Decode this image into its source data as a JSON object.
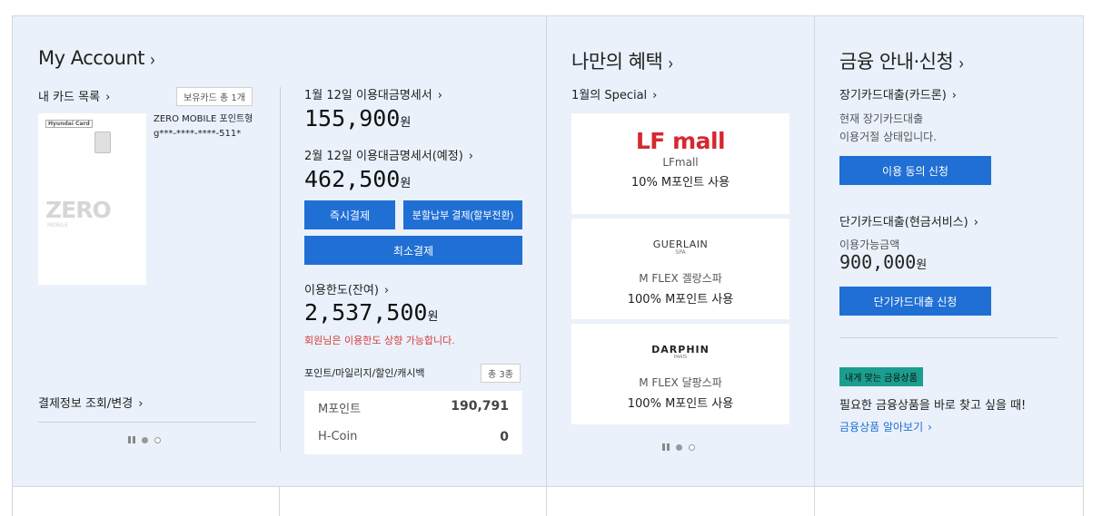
{
  "account": {
    "title": "My Account",
    "card_list_label": "내 카드 목록",
    "card_count_badge": "보유카드 총 1개",
    "card_brand": "Hyundai Card",
    "card_logo_big": "ZERO",
    "card_logo_small": "MOBILE",
    "card_name": "ZERO MOBILE 포인트형",
    "card_number": "g***-****-****-511*",
    "payment_info_link": "결제정보 조회/변경"
  },
  "billing": {
    "jan_label": "1월 12일 이용대금명세서",
    "jan_amount": "155,900",
    "feb_label": "2월 12일 이용대금명세서(예정)",
    "feb_amount": "462,500",
    "won": "원",
    "pay_now_btn": "즉시결제",
    "installment_btn": "분할납부 결제(할부전환)",
    "min_pay_btn": "최소결제",
    "limit_label": "이용한도(잔여)",
    "limit_amount": "2,537,500",
    "limit_notice": "회원님은 이용한도 상향 가능합니다.",
    "points_label": "포인트/마일리지/할인/캐시백",
    "points_badge": "총 3종",
    "points": [
      {
        "name": "M포인트",
        "value": "190,791"
      },
      {
        "name": "H-Coin",
        "value": "0"
      }
    ]
  },
  "benefits": {
    "title": "나만의 혜택",
    "special_label": "1월의 Special",
    "items": [
      {
        "logo": "LF mall",
        "name": "LFmall",
        "desc": "10% M포인트 사용"
      },
      {
        "logo": "GUERLAIN",
        "logo_sub": "SPA",
        "name": "M FLEX 겔랑스파",
        "desc": "100% M포인트 사용"
      },
      {
        "logo": "DARPHIN",
        "logo_sub": "PARIS",
        "name": "M FLEX 달팡스파",
        "desc": "100% M포인트 사용"
      }
    ]
  },
  "finance": {
    "title": "금융 안내·신청",
    "long_loan_label": "장기카드대출(카드론)",
    "long_loan_status": "현재 장기카드대출\n이용거절 상태입니다.",
    "consent_btn": "이용 동의 신청",
    "short_loan_label": "단기카드대출(현금서비스)",
    "available_label": "이용가능금액",
    "available_amount": "900,000",
    "short_loan_btn": "단기카드대출 신청",
    "product_badge": "내게 맞는 금융상품",
    "product_text": "필요한 금융상품을 바로 찾고 싶을 때!",
    "product_link": "금융상품 알아보기"
  },
  "colors": {
    "accent": "#1f6fd4",
    "panel_bg": "#eaf1fa",
    "notice_red": "#d93a3a",
    "badge_teal": "#1a9e8f",
    "lfmall_red": "#d7282f"
  }
}
